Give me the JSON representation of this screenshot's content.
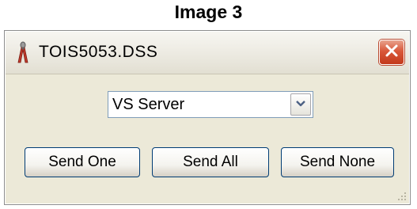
{
  "caption": "Image 3",
  "window": {
    "title": "TOIS5053.DSS",
    "icon": "pliers-icon",
    "close_icon": "close-icon"
  },
  "combo": {
    "value": "VS Server",
    "dropdown_icon": "chevron-down-icon"
  },
  "buttons": {
    "send_one": "Send One",
    "send_all": "Send All",
    "send_none": "Send None"
  },
  "colors": {
    "close_button": "#d9583a",
    "dialog_background": "#ece9d8",
    "button_border": "#003c74"
  }
}
